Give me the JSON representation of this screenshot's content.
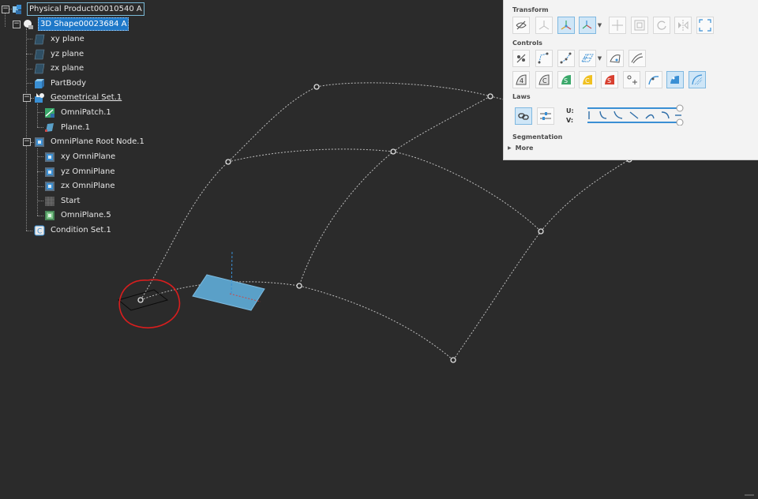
{
  "tree": {
    "root": "Physical Product00010540 A",
    "shape": "3D Shape00023684 A",
    "xy_plane": "xy plane",
    "yz_plane": "yz plane",
    "zx_plane": "zx plane",
    "partbody": "PartBody",
    "geoset": "Geometrical Set.1",
    "omnipatch": "OmniPatch.1",
    "plane1": "Plane.1",
    "omniroot": "OmniPlane Root Node.1",
    "xy_omni": "xy OmniPlane",
    "yz_omni": "yz OmniPlane",
    "zx_omni": "zx OmniPlane",
    "start": "Start",
    "omni5": "OmniPlane.5",
    "condset": "Condition Set.1"
  },
  "panel": {
    "transform_label": "Transform",
    "controls_label": "Controls",
    "laws_label": "Laws",
    "segmentation_label": "Segmentation",
    "more_label": "More",
    "u_label": "U:",
    "v_label": "V:"
  },
  "colors": {
    "viewport_bg": "#2b2b2b",
    "accent_blue": "#1e78c8",
    "annotation_red": "#d81e1e",
    "plane_blue": "#5aa0c8"
  }
}
